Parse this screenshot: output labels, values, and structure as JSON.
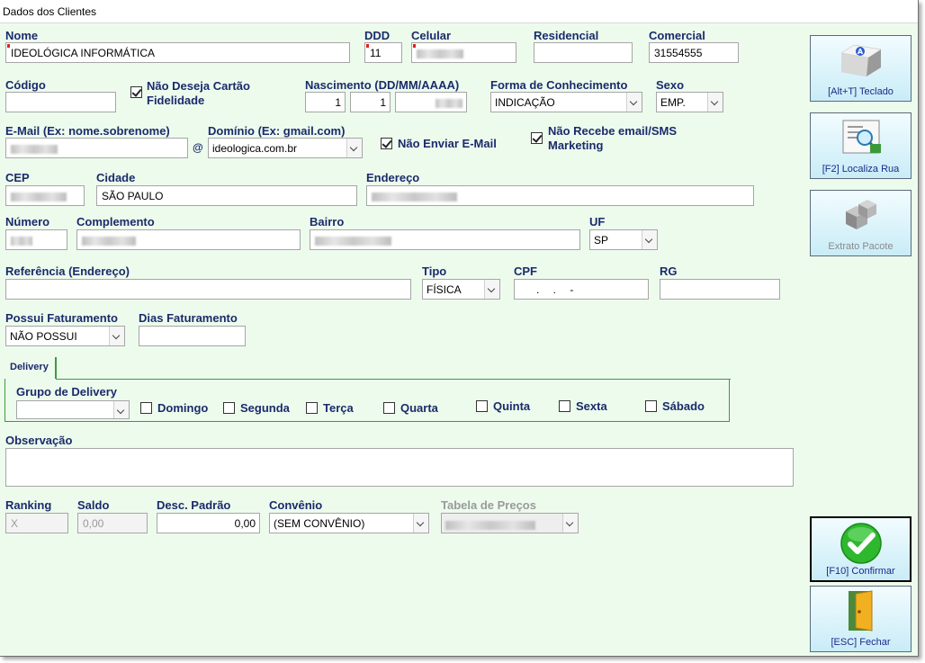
{
  "window": {
    "title": "Dados dos Clientes"
  },
  "fields": {
    "nome": {
      "label": "Nome",
      "value": "IDEOLÓGICA INFORMÁTICA"
    },
    "ddd": {
      "label": "DDD",
      "value": "11"
    },
    "celular": {
      "label": "Celular"
    },
    "residencial": {
      "label": "Residencial",
      "value": ""
    },
    "comercial": {
      "label": "Comercial",
      "value": "31554555"
    },
    "codigo": {
      "label": "Código",
      "value": ""
    },
    "nao_cartao": {
      "label": "Não Deseja Cartão Fidelidade",
      "checked": true
    },
    "nascimento": {
      "label": "Nascimento (DD/MM/AAAA)",
      "day": "1",
      "month": "1"
    },
    "forma_conhecimento": {
      "label": "Forma de Conhecimento",
      "value": "INDICAÇÃO"
    },
    "sexo": {
      "label": "Sexo",
      "value": "EMP."
    },
    "email": {
      "label": "E-Mail (Ex: nome.sobrenome)",
      "at": "@"
    },
    "dominio": {
      "label": "Domínio (Ex: gmail.com)",
      "value": "ideologica.com.br"
    },
    "nao_enviar_email": {
      "label": "Não Enviar E-Mail",
      "checked": true
    },
    "nao_recebe_marketing": {
      "label": "Não Recebe email/SMS Marketing",
      "checked": true
    },
    "cep": {
      "label": "CEP"
    },
    "cidade": {
      "label": "Cidade",
      "value": "SÃO PAULO"
    },
    "endereco": {
      "label": "Endereço"
    },
    "numero": {
      "label": "Número"
    },
    "complemento": {
      "label": "Complemento"
    },
    "bairro": {
      "label": "Bairro"
    },
    "uf": {
      "label": "UF",
      "value": "SP"
    },
    "referencia": {
      "label": "Referência (Endereço)",
      "value": ""
    },
    "tipo": {
      "label": "Tipo",
      "value": "FÍSICA"
    },
    "cpf": {
      "label": "CPF",
      "value": ".  .  -"
    },
    "rg": {
      "label": "RG",
      "value": ""
    },
    "possui_faturamento": {
      "label": "Possui Faturamento",
      "value": "NÃO POSSUI"
    },
    "dias_faturamento": {
      "label": "Dias Faturamento",
      "value": ""
    },
    "observacao": {
      "label": "Observação",
      "value": ""
    },
    "ranking": {
      "label": "Ranking",
      "value": "X"
    },
    "saldo": {
      "label": "Saldo",
      "value": "0,00"
    },
    "desc_padrao": {
      "label": "Desc. Padrão",
      "value": "0,00"
    },
    "convenio": {
      "label": "Convênio",
      "value": "(SEM CONVÊNIO)"
    },
    "tabela_precos": {
      "label": "Tabela de Preços"
    }
  },
  "delivery": {
    "tab_label": "Delivery",
    "grupo_label": "Grupo de Delivery",
    "days": [
      {
        "label": "Domingo",
        "checked": false
      },
      {
        "label": "Segunda",
        "checked": false
      },
      {
        "label": "Terça",
        "checked": false
      },
      {
        "label": "Quarta",
        "checked": false
      },
      {
        "label": "Quinta",
        "checked": false
      },
      {
        "label": "Sexta",
        "checked": false
      },
      {
        "label": "Sábado",
        "checked": false
      }
    ]
  },
  "toolbar": {
    "teclado": "[Alt+T] Teclado",
    "localiza_rua": "[F2] Localiza Rua",
    "extrato_pacote": "Extrato Pacote",
    "confirmar": "[F10] Confirmar",
    "fechar": "[ESC] Fechar"
  }
}
